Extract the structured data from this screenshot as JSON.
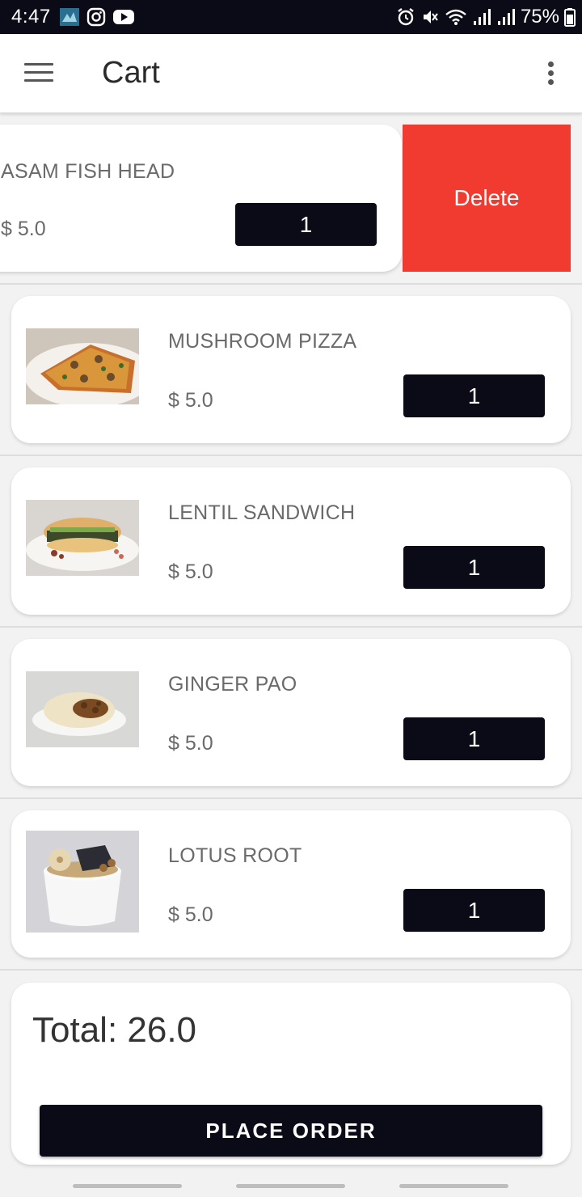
{
  "status_bar": {
    "time": "4:47",
    "battery": "75%"
  },
  "app_bar": {
    "title": "Cart"
  },
  "swiped_item": {
    "name": "ASAM FISH HEAD",
    "price": "$ 5.0",
    "quantity": "1",
    "delete_label": "Delete"
  },
  "items": [
    {
      "name": "MUSHROOM PIZZA",
      "price": "$ 5.0",
      "quantity": "1"
    },
    {
      "name": "LENTIL SANDWICH",
      "price": "$ 5.0",
      "quantity": "1"
    },
    {
      "name": "GINGER PAO",
      "price": "$ 5.0",
      "quantity": "1"
    },
    {
      "name": "LOTUS ROOT",
      "price": "$ 5.0",
      "quantity": "1"
    }
  ],
  "summary": {
    "total": "Total: 26.0",
    "place_order_label": "PLACE ORDER"
  },
  "colors": {
    "dark": "#0b0b17",
    "delete": "#f23b30"
  }
}
